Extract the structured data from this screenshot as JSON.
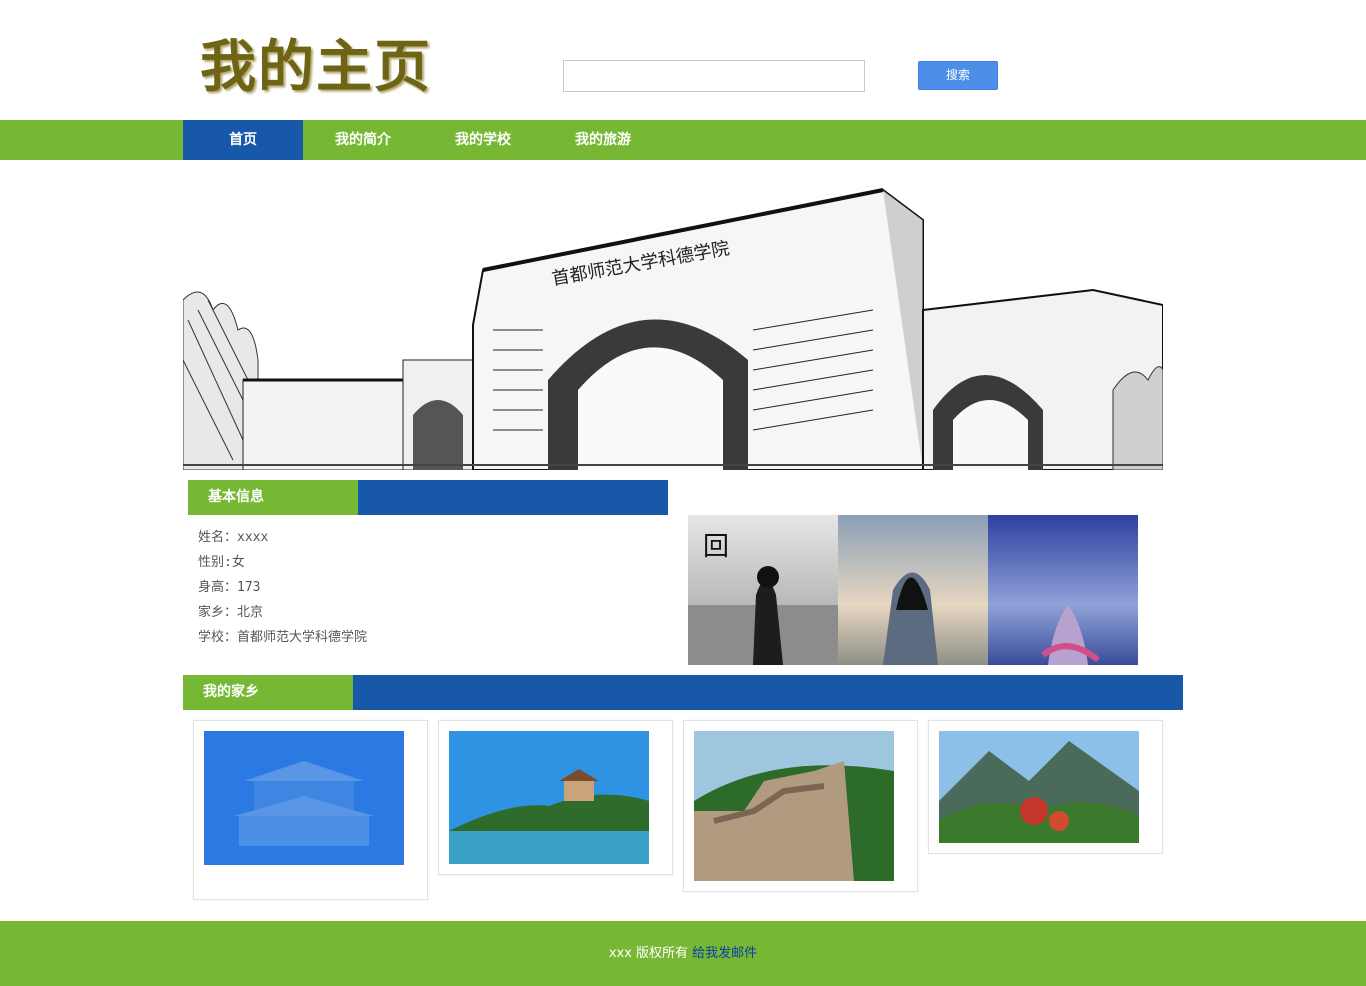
{
  "header": {
    "logo": "我的主页",
    "search": {
      "placeholder": "",
      "value": ""
    },
    "search_button_label": "搜索"
  },
  "nav": {
    "items": [
      {
        "label": "首页",
        "active": true
      },
      {
        "label": "我的简介",
        "active": false
      },
      {
        "label": "我的学校",
        "active": false
      },
      {
        "label": "我的旅游",
        "active": false
      }
    ]
  },
  "basic_info": {
    "title": "基本信息",
    "lines": [
      "姓名：xxxx",
      "性别:女",
      "身高：173",
      "家乡：北京",
      "学校：首都师范大学科德学院"
    ]
  },
  "hometown": {
    "title": "我的家乡"
  },
  "footer": {
    "copyright": "xxx  版权所有",
    "email_link": "给我发邮件"
  },
  "colors": {
    "green": "#76b734",
    "blue": "#1858a8",
    "logo": "#6e6416",
    "search_button": "#4d8ee8"
  }
}
